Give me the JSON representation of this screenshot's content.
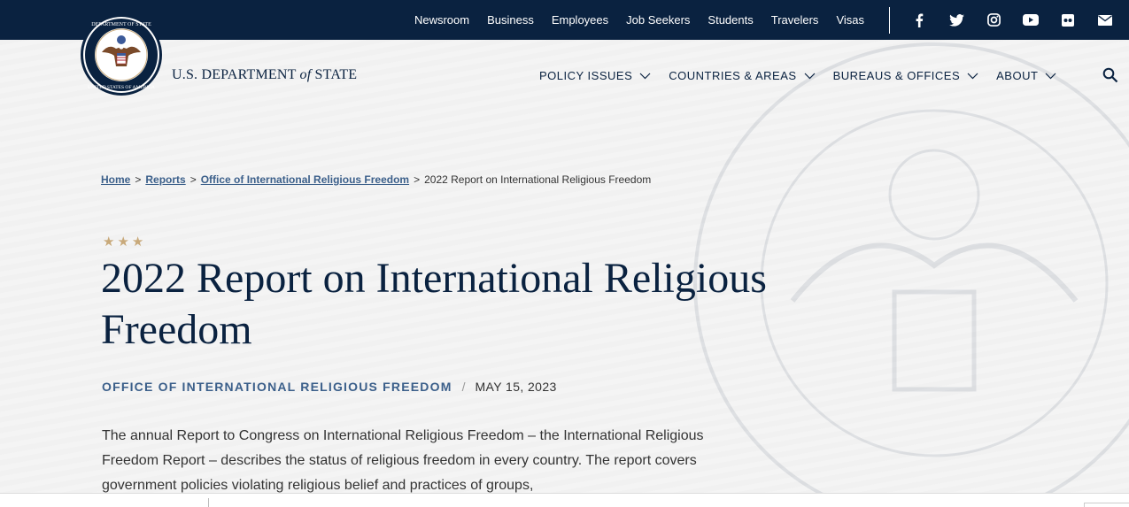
{
  "topbar": {
    "links": [
      "Newsroom",
      "Business",
      "Employees",
      "Job Seekers",
      "Students",
      "Travelers",
      "Visas"
    ],
    "social_icons": [
      "facebook-icon",
      "twitter-icon",
      "instagram-icon",
      "youtube-icon",
      "flickr-icon",
      "email-icon"
    ]
  },
  "header": {
    "agency_prefix": "U.S. DEPARTMENT ",
    "agency_of": "of",
    "agency_suffix": " STATE",
    "nav": [
      "POLICY ISSUES",
      "COUNTRIES & AREAS",
      "BUREAUS & OFFICES",
      "ABOUT"
    ]
  },
  "breadcrumb": {
    "items": [
      "Home",
      "Reports",
      "Office of International Religious Freedom"
    ],
    "current": "2022 Report on International Religious Freedom",
    "separator": ">"
  },
  "stars": "★★★",
  "page_title": "2022 Report on International Religious Freedom",
  "meta": {
    "office": "OFFICE OF INTERNATIONAL RELIGIOUS FREEDOM",
    "slash": "/",
    "date": "MAY 15, 2023"
  },
  "intro": "The annual Report to Congress on International Religious Freedom – the International Religious Freedom Report – describes the status of religious freedom in every country. The report covers government policies violating religious belief and practices of groups,",
  "colors": {
    "navy": "#0a2240",
    "link": "#3b5f8a",
    "gold": "#c8a97a"
  }
}
